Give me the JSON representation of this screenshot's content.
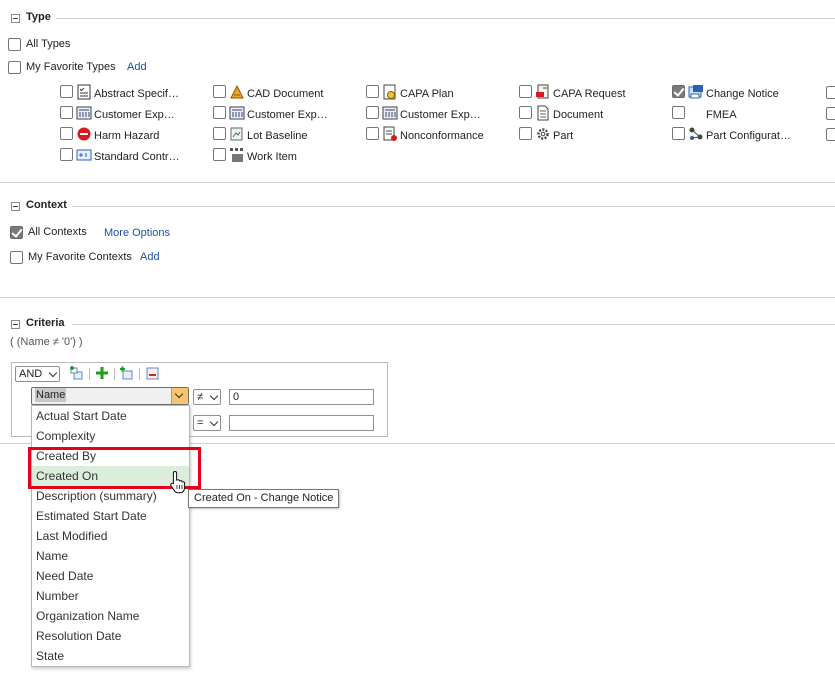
{
  "type_section": {
    "title": "Type",
    "all_types": "All Types",
    "favorite_types": "My Favorite Types",
    "add": "Add",
    "items": [
      {
        "label": "Abstract Specif…",
        "icon": "abstract-spec-icon",
        "checked": false
      },
      {
        "label": "Customer Exp…",
        "icon": "customer-experience-icon",
        "checked": false
      },
      {
        "label": "Harm Hazard",
        "icon": "harm-hazard-icon",
        "checked": false
      },
      {
        "label": "Standard Contr…",
        "icon": "standard-control-icon",
        "checked": false
      },
      {
        "label": "CAD Document",
        "icon": "cad-document-icon",
        "checked": false
      },
      {
        "label": "Customer Exp…",
        "icon": "customer-experience-icon",
        "checked": false
      },
      {
        "label": "Lot Baseline",
        "icon": "lot-baseline-icon",
        "checked": false
      },
      {
        "label": "Work Item",
        "icon": "work-item-icon",
        "checked": false
      },
      {
        "label": "CAPA Plan",
        "icon": "capa-plan-icon",
        "checked": false
      },
      {
        "label": "Customer Exp…",
        "icon": "customer-experience-icon",
        "checked": false
      },
      {
        "label": "Nonconformance",
        "icon": "nonconformance-icon",
        "checked": false
      },
      {
        "label": "CAPA Request",
        "icon": "capa-request-icon",
        "checked": false
      },
      {
        "label": "Document",
        "icon": "document-icon",
        "checked": false
      },
      {
        "label": "Part",
        "icon": "part-gear-icon",
        "checked": false
      },
      {
        "label": "Change Notice",
        "icon": "change-notice-icon",
        "checked": true
      },
      {
        "label": "FMEA",
        "icon": "",
        "checked": false
      },
      {
        "label": "Part Configurat…",
        "icon": "part-configuration-icon",
        "checked": false
      }
    ]
  },
  "context_section": {
    "title": "Context",
    "all_contexts": "All Contexts",
    "more_options": "More Options",
    "favorite_contexts": "My Favorite Contexts",
    "add": "Add"
  },
  "criteria_section": {
    "title": "Criteria",
    "expression": "( (Name ≠ '0') )",
    "logic_operator": "AND",
    "row1": {
      "attribute": "Name",
      "operator": "≠",
      "value": "0"
    },
    "row2": {
      "operator": "=",
      "value": ""
    }
  },
  "attribute_dropdown": {
    "options": [
      "Actual Start Date",
      "Complexity",
      "Created By",
      "Created On",
      "Description (summary)",
      "Estimated Start Date",
      "Last Modified",
      "Name",
      "Need Date",
      "Number",
      "Organization Name",
      "Resolution Date",
      "State"
    ],
    "highlighted": "Created On"
  },
  "tooltip": "Created On - Change Notice",
  "colors": {
    "link": "#1a4f9c",
    "highlight": "#dbeedb",
    "annotation_red": "#e3001b"
  }
}
